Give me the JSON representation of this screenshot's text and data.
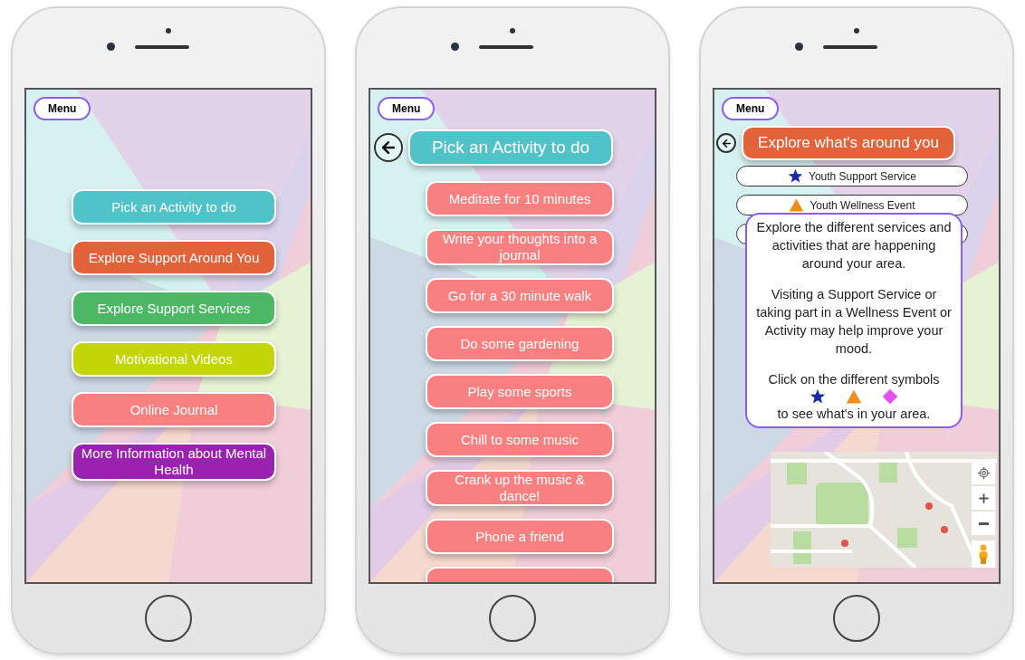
{
  "home": {
    "menu": "Menu",
    "buttons": [
      {
        "label": "Pick an Activity to do",
        "color": "#4fc3c8"
      },
      {
        "label": "Explore Support Around You",
        "color": "#e2623a"
      },
      {
        "label": "Explore Support Services",
        "color": "#4cb865"
      },
      {
        "label": "Motivational Videos",
        "color": "#c3d60a"
      },
      {
        "label": "Online Journal",
        "color": "#f98080"
      },
      {
        "label": "More Information about Mental Health",
        "color": "#9b22b0"
      }
    ]
  },
  "activities": {
    "menu": "Menu",
    "title": "Pick an Activity to do",
    "items": [
      "Meditate for 10 minutes",
      "Write your thoughts into a journal",
      "Go for a 30 minute walk",
      "Do some gardening",
      "Play some sports",
      "Chill to some music",
      "Crank up the music & dance!",
      "Phone a friend"
    ]
  },
  "explore": {
    "menu": "Menu",
    "title": "Explore what's around you",
    "legend": [
      {
        "label": "Youth Support Service",
        "kind": "star",
        "color": "#1a2aa8"
      },
      {
        "label": "Youth Wellness Event",
        "kind": "triangle",
        "color": "#f28c1c"
      }
    ],
    "popup": {
      "paragraphs": [
        "Explore the different services and activities that are happening around your area.",
        "Visiting a Support Service or taking part in a Wellness Event or Activity may help improve your mood.",
        "Click on the different symbols"
      ],
      "symbols": [
        {
          "kind": "star",
          "color": "#1a2aa8"
        },
        {
          "kind": "triangle",
          "color": "#f28c1c"
        },
        {
          "kind": "diamond",
          "color": "#e64ff0"
        }
      ],
      "footer": "to see what's in your area."
    }
  }
}
